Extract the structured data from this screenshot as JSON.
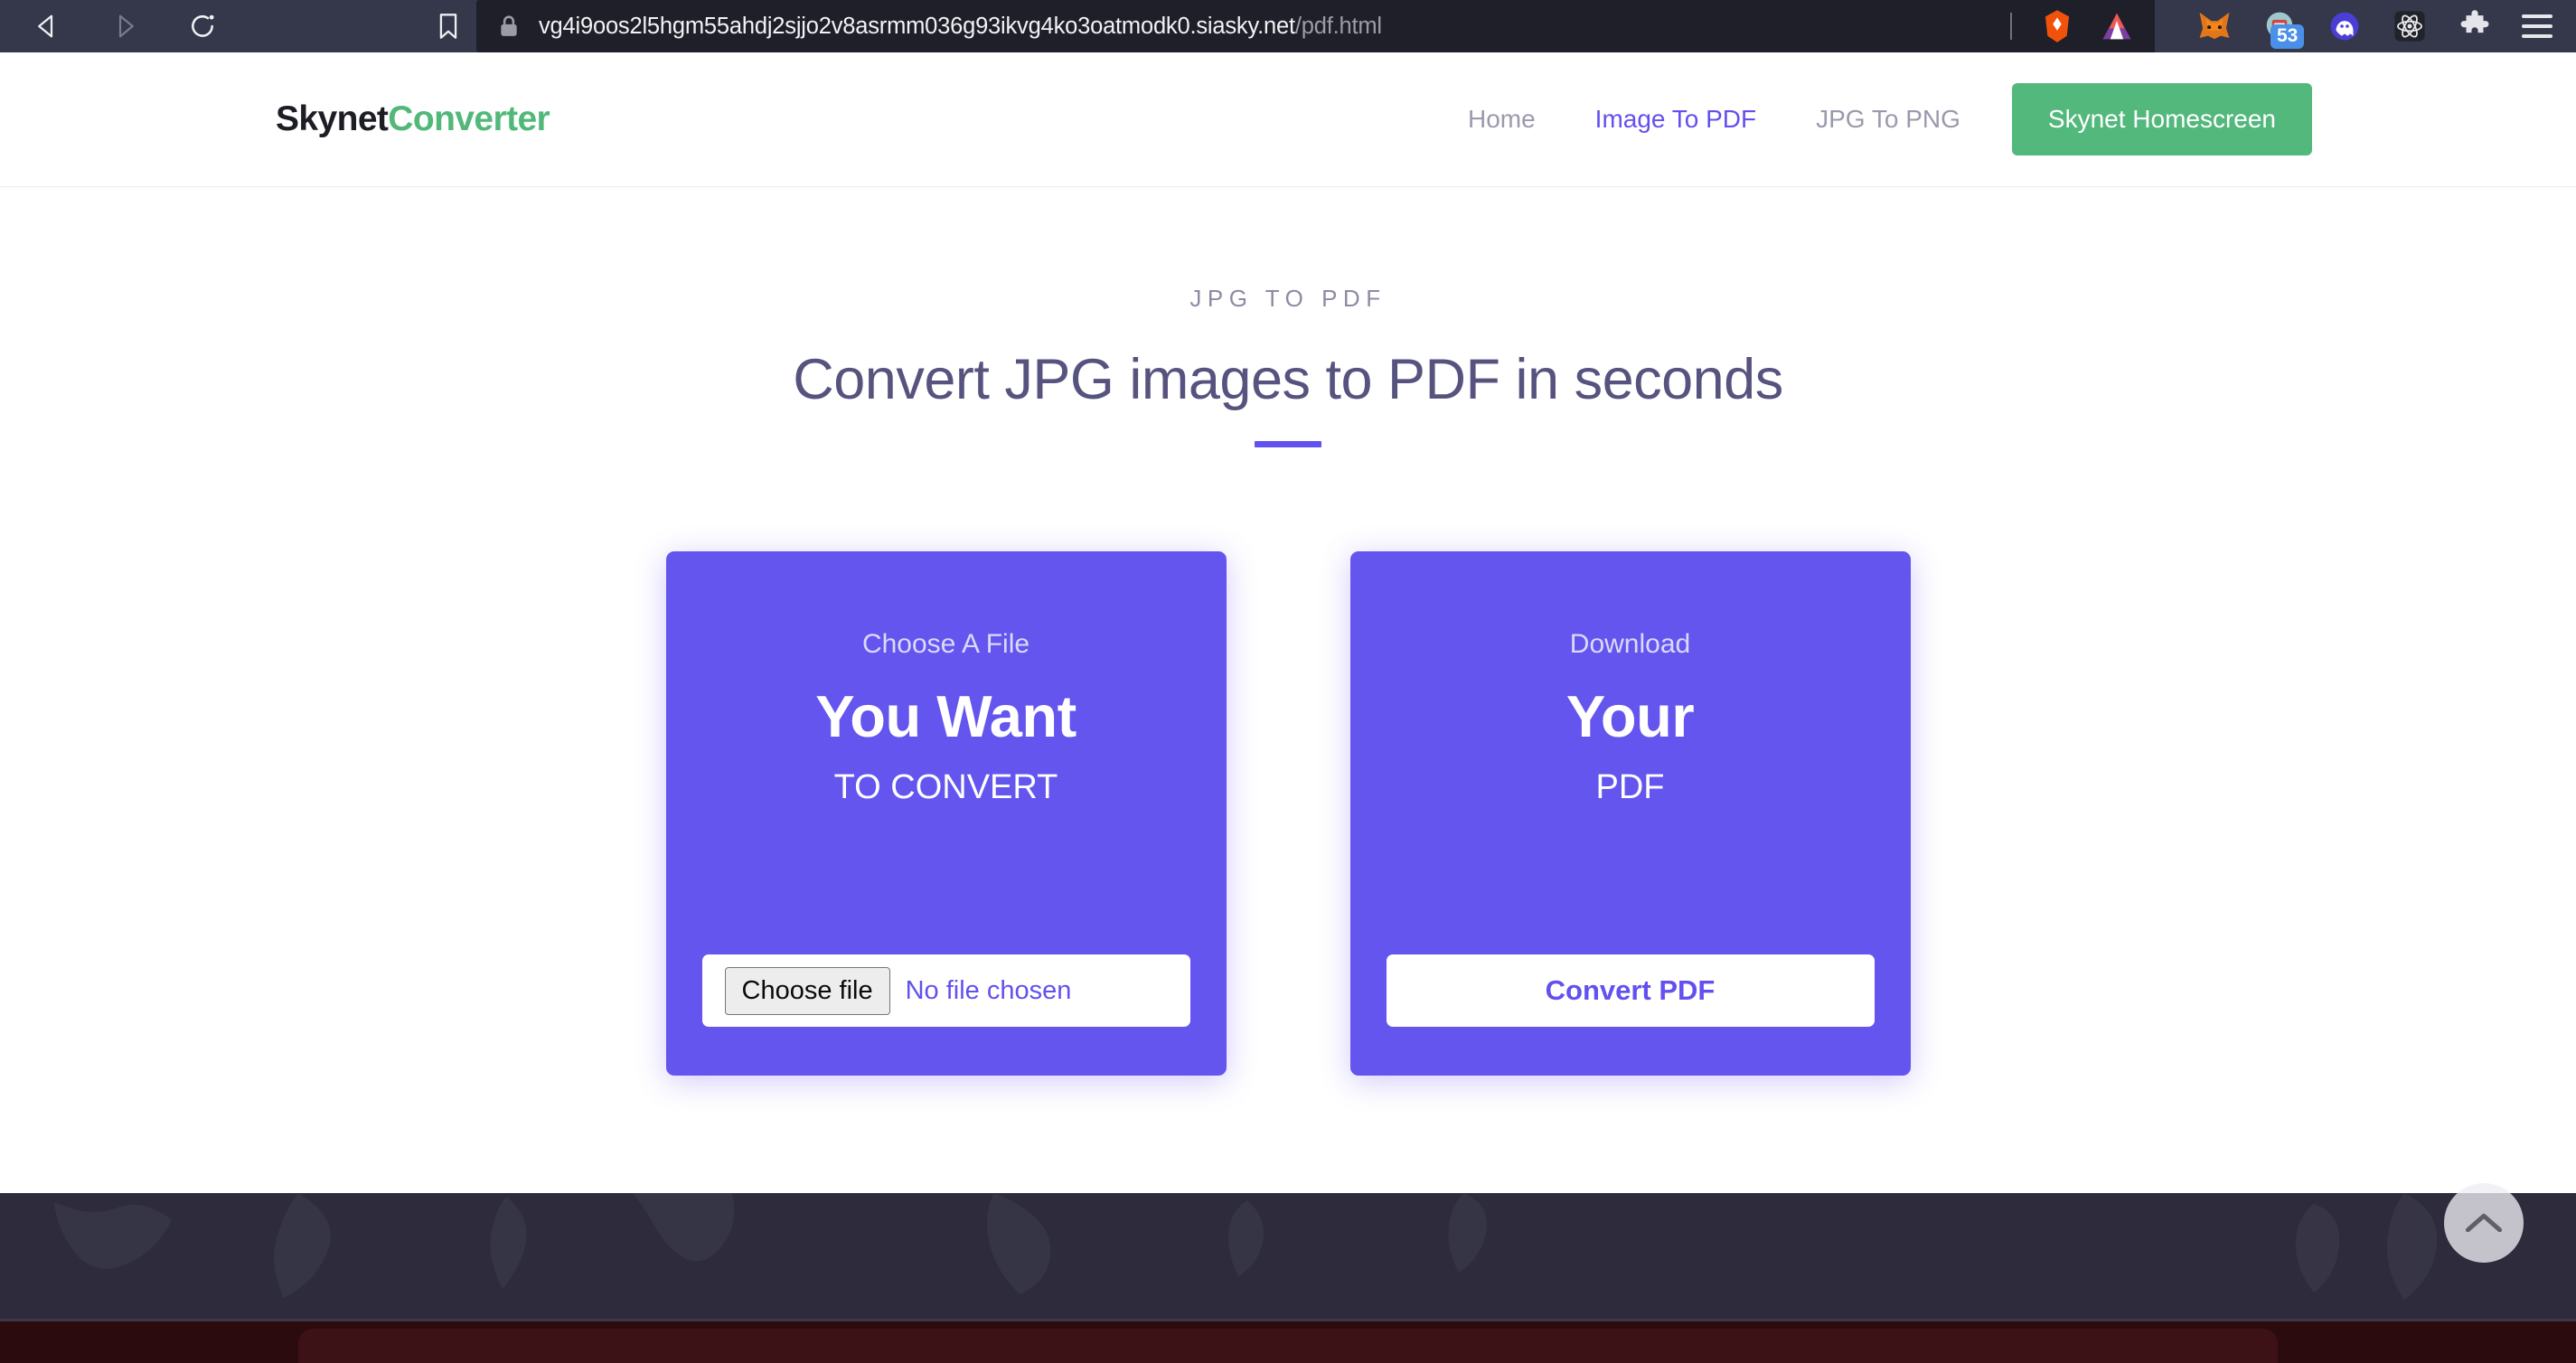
{
  "browser": {
    "back_label": "Back",
    "forward_label": "Forward",
    "reload_label": "Reload",
    "bookmark_label": "Bookmark",
    "url_host": "vg4i9oos2l5hgm55ahdj2sjjo2v8asrmm036g93ikvg4ko3oatmodk0.siasky.net",
    "url_path": "/pdf.html",
    "extensions": [
      {
        "name": "metamask-icon",
        "badge": ""
      },
      {
        "name": "wallet-icon",
        "badge": "53"
      },
      {
        "name": "phantom-ghost-icon",
        "badge": ""
      },
      {
        "name": "react-atom-icon",
        "badge": ""
      },
      {
        "name": "puzzle-extensions-icon",
        "badge": ""
      }
    ],
    "menu_label": "Menu"
  },
  "header": {
    "logo_primary": "Skynet",
    "logo_accent": "Converter",
    "nav": [
      {
        "label": "Home",
        "active": false
      },
      {
        "label": "Image To PDF",
        "active": true
      },
      {
        "label": "JPG To PNG",
        "active": false
      }
    ],
    "cta_label": "Skynet Homescreen"
  },
  "hero": {
    "eyebrow": "JPG TO PDF",
    "title": "Convert JPG images to PDF in seconds"
  },
  "cards": {
    "upload": {
      "kicker": "Choose A File",
      "big": "You Want",
      "sub": "TO CONVERT",
      "button_label": "Choose file",
      "file_status": "No file chosen"
    },
    "download": {
      "kicker": "Download",
      "big": "Your",
      "sub": "PDF",
      "button_label": "Convert PDF"
    }
  },
  "footer": {
    "scroll_top_label": "Scroll to top"
  },
  "colors": {
    "accent_purple": "#6350f0",
    "card_purple": "#6455ef",
    "brand_green": "#53b87c",
    "heading": "#56537f",
    "muted": "#9a9aad",
    "chrome_bg": "#34384a",
    "urlbar_bg": "#1e1f28",
    "footer_bg": "#2e2c3c"
  }
}
